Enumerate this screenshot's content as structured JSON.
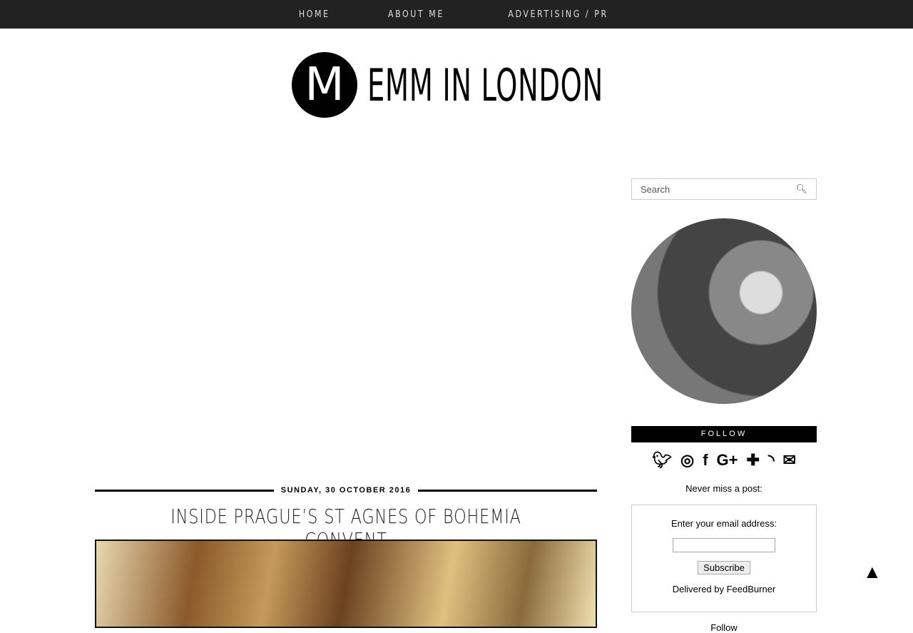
{
  "nav": {
    "items": [
      {
        "label": "HOME"
      },
      {
        "label": "ABOUT ME"
      },
      {
        "label": "ADVERTISING / PR"
      }
    ]
  },
  "logo": {
    "letter": "M",
    "text": "EMM IN LONDON"
  },
  "sidebar": {
    "search_placeholder": "Search",
    "follow_title": "FOLLOW",
    "social_icons": [
      "twitter-icon",
      "instagram-icon",
      "facebook-icon",
      "google-plus-icon",
      "bloglovin-icon",
      "rss-icon",
      "email-icon"
    ],
    "never_miss": "Never miss a post:",
    "feedburner": {
      "label": "Enter your email address:",
      "email_value": "",
      "button": "Subscribe",
      "delivered": "Delivered by FeedBurner"
    },
    "follow_label": "Follow"
  },
  "post": {
    "date": "SUNDAY, 30 OCTOBER 2016",
    "title": "INSIDE PRAGUE’S ST AGNES OF BOHEMIA CONVENT"
  }
}
